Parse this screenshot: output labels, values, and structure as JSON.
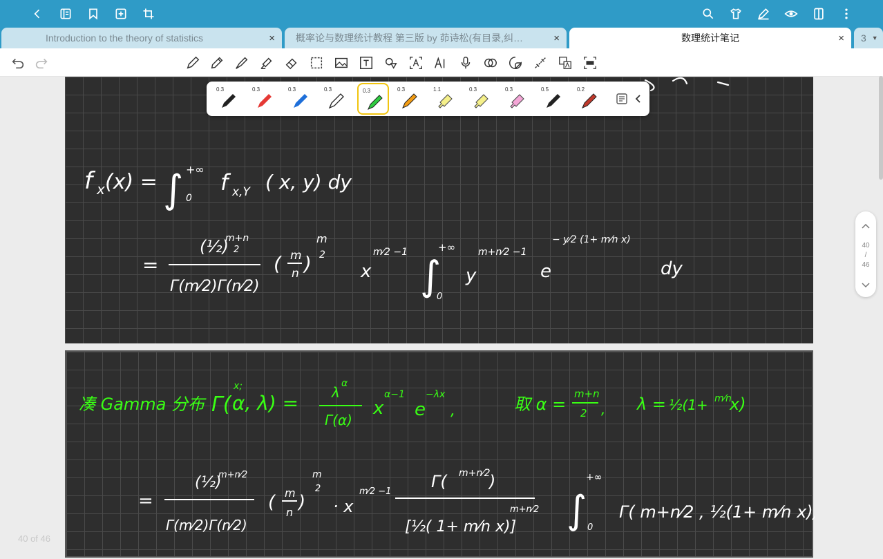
{
  "tabs": [
    {
      "title": "Introduction to the theory of statistics",
      "close": "×"
    },
    {
      "title": "概率论与数理统计教程 第三版 by 茆诗松(有目录,纠…",
      "close": "×"
    },
    {
      "title": "数理统计笔记",
      "close": "×"
    },
    {
      "title": "3"
    }
  ],
  "pens": [
    {
      "width": "0.3",
      "color": "#222222"
    },
    {
      "width": "0.3",
      "color": "#e53935"
    },
    {
      "width": "0.3",
      "color": "#1e6fd9"
    },
    {
      "width": "0.3",
      "color": "#ffffff"
    },
    {
      "width": "0.3",
      "color": "#2ecc40"
    },
    {
      "width": "0.3",
      "color": "#f39c12"
    },
    {
      "width": "1.1",
      "color": "#f5f08a"
    },
    {
      "width": "0.3",
      "color": "#f5f08a"
    },
    {
      "width": "0.3",
      "color": "#f4a6d7"
    },
    {
      "width": "0.5",
      "color": "#222222"
    },
    {
      "width": "0.2",
      "color": "#c0392b"
    }
  ],
  "pager": {
    "current": "40",
    "sep": "/",
    "total": "46"
  },
  "footer": {
    "page_label": "40 of 46"
  },
  "note": {
    "line1": "f_X(x) = ∫₀^{+∞} f_{X,Y}(x, y) dy",
    "line2": "= [(1/2)^{(m+n)/2} / (Γ(m/2)Γ(n/2))] (m/n)^{m/2} x^{m/2 - 1} ∫₀^{+∞} y^{(m+n)/2 - 1} e^{-(y/2)(1 + (m/n)x)} dy",
    "line3": "凑 Gamma 分布  Γ(α, λ) = λ^α / Γ(α) x^{α-1} e^{-λx},  取 α = (m+n)/2,  λ = 1/2 (1 + (m/n)x)",
    "line4": "= [(1/2)^{(m+n)/2} / (Γ(m/2)Γ(n/2))] (m/n)^{m/2} · x^{m/2 - 1} Γ((m+n)/2) / [1/2 (1 + (m/n)x)]^{(m+n)/2} ∫₀^{+∞} Γ((m+n)/2, 1/2 (1 + (m/n)x)) dy"
  },
  "colors": {
    "accent": "#2f9bc7",
    "ink_white": "#ffffff",
    "ink_green": "#39ff14",
    "board": "#2e2e2e"
  }
}
